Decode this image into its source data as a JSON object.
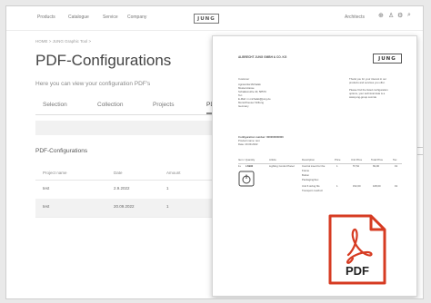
{
  "nav": {
    "items": [
      "Products",
      "Catalogue",
      "Service",
      "Company"
    ],
    "logo": "JUNG",
    "account": "Architects"
  },
  "breadcrumb": "HOME > JUNG Graphic Tool >",
  "page_title": "PDF-Configurations",
  "subtitle": "Here you can view your configuration PDF's",
  "tabs": [
    "Selection",
    "Collection",
    "Projects",
    "PDF-Co"
  ],
  "section_title": "PDF-Configurations",
  "table": {
    "headers": [
      "Project name",
      "Date",
      "Amount"
    ],
    "rows": [
      [
        "test",
        "2.9.2022",
        "1"
      ],
      [
        "test",
        "20.09.2022",
        "1"
      ]
    ]
  },
  "side_button": "",
  "doc": {
    "company": "ALBRECHT JUNG GMBH & CO. KG",
    "logo": "JUNG",
    "customer_block": [
      "Customer",
      "Agnieszka Michalak",
      "Musterstrasse",
      "Schalksmuhle 40, 58579",
      "Tel.:",
      "E-Mail: m.michalak@jung.de",
      "Morschheuser Stiftung",
      "Germany"
    ],
    "right_block": [
      "Thank you for your interest in our",
      "products and services you offer.",
      "",
      "Please find the listed configuration",
      "options, your technical data is a",
      "www.jung-group.com/de"
    ],
    "config_lines": [
      "Configuration number: 000000000000",
      "Product name: test",
      "Date: 20.09.2022"
    ],
    "table_headers": [
      "Item / Quantity",
      "Article",
      "Description",
      "Price",
      "Unit Price",
      "Total Price",
      "Tax"
    ],
    "rows": [
      [
        "1x",
        "LS990",
        "Lighting Control Panel",
        "Control insert for the",
        "1",
        "57,52",
        "69,90",
        "19"
      ],
      [
        "",
        "",
        "",
        "Frame",
        "",
        "",
        "",
        ""
      ],
      [
        "",
        "",
        "",
        "Button",
        "",
        "",
        "",
        ""
      ],
      [
        "",
        "",
        "",
        "Packaging/box",
        "",
        "",
        "",
        ""
      ],
      [
        "",
        "",
        "",
        "Unit 6 sizing fits",
        "1",
        "152,00",
        "168,00",
        "19"
      ],
      [
        "",
        "",
        "",
        "Transport cost/incl",
        "",
        "",
        "",
        ""
      ]
    ],
    "pdf_label": "PDF"
  },
  "colors": {
    "pdf_red": "#d63b22",
    "accent": "#888888"
  }
}
